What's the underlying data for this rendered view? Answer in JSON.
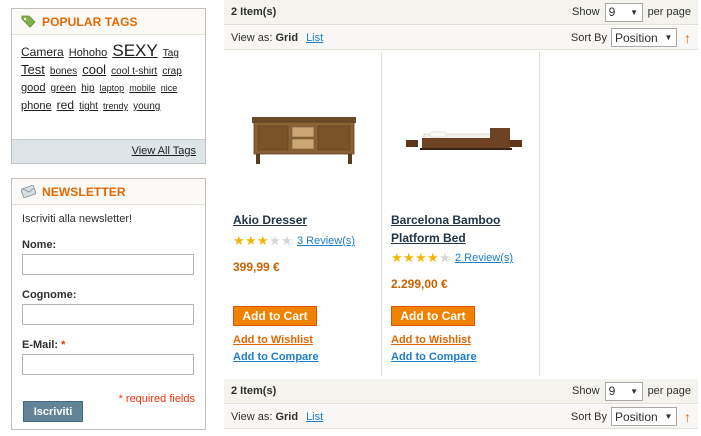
{
  "popular_tags": {
    "title": "Popular Tags",
    "tags": [
      {
        "label": "Camera",
        "size": 12
      },
      {
        "label": "Hohoho",
        "size": 11
      },
      {
        "label": "SEXY",
        "size": 17
      },
      {
        "label": "Tag",
        "size": 10
      },
      {
        "label": "Test",
        "size": 13
      },
      {
        "label": "bones",
        "size": 10
      },
      {
        "label": "cool",
        "size": 13
      },
      {
        "label": "cool t-shirt",
        "size": 10
      },
      {
        "label": "crap",
        "size": 10
      },
      {
        "label": "good",
        "size": 11
      },
      {
        "label": "green",
        "size": 10
      },
      {
        "label": "hip",
        "size": 10
      },
      {
        "label": "laptop",
        "size": 9
      },
      {
        "label": "mobile",
        "size": 9
      },
      {
        "label": "nice",
        "size": 9
      },
      {
        "label": "phone",
        "size": 11
      },
      {
        "label": "red",
        "size": 12
      },
      {
        "label": "tight",
        "size": 10
      },
      {
        "label": "trendy",
        "size": 9
      },
      {
        "label": "young",
        "size": 10
      }
    ],
    "view_all": "View All Tags"
  },
  "newsletter": {
    "title": "Newsletter",
    "intro": "Iscriviti alla newsletter!",
    "fields": {
      "nome": "Nome:",
      "cognome": "Cognome:",
      "email": "E-Mail:",
      "required_star": "*"
    },
    "required_note": "* required fields",
    "submit": "Iscriviti"
  },
  "toolbar": {
    "item_count": "2 Item(s)",
    "show_label": "Show",
    "show_value": "9",
    "per_page": "per page",
    "view_as": "View as:",
    "view_grid": "Grid",
    "view_list": "List",
    "sort_by": "Sort By",
    "sort_value": "Position",
    "sort_arrow": "↑"
  },
  "products": [
    {
      "name": "Akio Dresser",
      "rating": 3,
      "rating_max": 5,
      "reviews": "3 Review(s)",
      "price": "399,99 €",
      "add_to_cart": "Add to Cart",
      "wishlist": "Add to Wishlist",
      "compare": "Add to Compare"
    },
    {
      "name": "Barcelona Bamboo Platform Bed",
      "rating": 4,
      "rating_max": 5,
      "reviews": "2 Review(s)",
      "price": "2.299,00 €",
      "add_to_cart": "Add to Cart",
      "wishlist": "Add to Wishlist",
      "compare": "Add to Compare"
    }
  ],
  "colors": {
    "accent_orange": "#e26703",
    "link_blue": "#1e7ec8",
    "price_orange": "#c76200",
    "button_orange": "#f18200",
    "button_blue": "#618499",
    "star_on": "#f4b400"
  }
}
